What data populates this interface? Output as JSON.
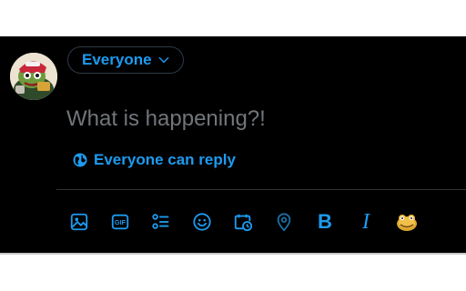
{
  "composer": {
    "audience_label": "Everyone",
    "placeholder": "What is happening?!",
    "reply_setting_label": "Everyone can reply"
  },
  "toolbar": {
    "items": [
      {
        "name": "media-icon",
        "text": ""
      },
      {
        "name": "gif-icon",
        "text": "GIF"
      },
      {
        "name": "poll-icon",
        "text": ""
      },
      {
        "name": "emoji-icon",
        "text": ""
      },
      {
        "name": "schedule-icon",
        "text": ""
      },
      {
        "name": "location-icon",
        "text": ""
      },
      {
        "name": "bold-icon",
        "text": "B"
      },
      {
        "name": "italic-icon",
        "text": "I"
      },
      {
        "name": "custom-emoji-icon",
        "text": ""
      }
    ]
  },
  "colors": {
    "background": "#000000",
    "accent": "#1d9bf0",
    "placeholder": "#71767b",
    "divider": "#2f3336"
  }
}
